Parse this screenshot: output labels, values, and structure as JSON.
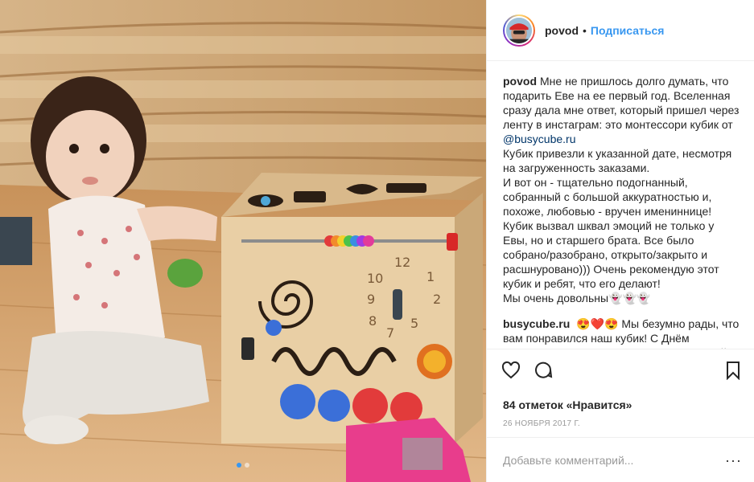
{
  "media": {
    "carousel": {
      "count": 2,
      "active_index": 0
    }
  },
  "header": {
    "username": "povod",
    "separator": "•",
    "follow_label": "Подписаться"
  },
  "comments": [
    {
      "author": "povod",
      "text_before": "Мне не пришлось долго думать, что подарить Еве на ее первый год. Вселенная сразу дала мне ответ, который пришел через ленту в инстаграм: это монтессори кубик от ",
      "mention": "@busycube.ru",
      "text_after": "\nКубик привезли к указанной дате, несмотря на загруженность заказами.\nИ вот он - тщательно подогнанный, собранный с большой аккуратностью и, похоже, любовью - вручен имениннице! Кубик вызвал шквал эмоций не только у Евы, но и старшего брата. Все было собрано/разобрано, открыто/закрыто и расшнуровано))) Очень рекомендую этот кубик и ребят, что его делают!\nМы очень довольны👻👻👻"
    },
    {
      "author": "busycube.ru",
      "text": "😍❤️😍 Мы безумно рады, что вам понравился наш кубик! С Днём рождения! Пусть Ева растёт здоровенькой и умненькой!❤️🙏🏼✨☺️"
    }
  ],
  "actions": {
    "like_icon": "heart-icon",
    "comment_icon": "comment-icon",
    "save_icon": "bookmark-icon"
  },
  "likes_text": "84 отметок «Нравится»",
  "date_text": "26 ноября 2017 г.",
  "add_comment": {
    "placeholder": "Добавьте комментарий...",
    "more_label": "···"
  },
  "colors": {
    "link_blue": "#3897f0",
    "mention": "#003569",
    "text": "#262626",
    "muted": "#999999",
    "border": "#efefef"
  }
}
